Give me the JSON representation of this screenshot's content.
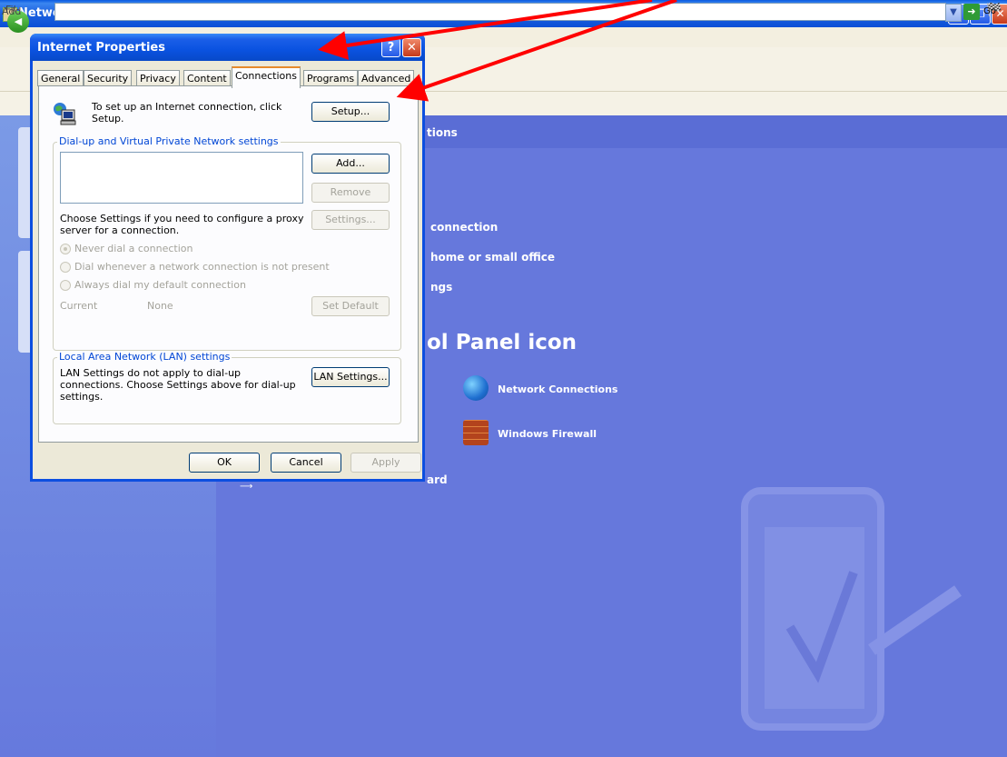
{
  "background_window": {
    "title": "Network and Internet Connections",
    "menu_visible_text": "Fil",
    "address_label": "Add",
    "go_label": "Go",
    "content_header": "tions",
    "tasks": [
      "connection",
      "home or small office",
      "ngs"
    ],
    "heading": "ol Panel icon",
    "control_panel_icons": [
      {
        "label": "Network Connections",
        "icon": "network-connections-icon"
      },
      {
        "label": "Windows Firewall",
        "icon": "windows-firewall-icon"
      }
    ],
    "bottom_task": "ard"
  },
  "dialog": {
    "title": "Internet Properties",
    "help_symbol": "?",
    "close_symbol": "✕",
    "tabs": [
      "General",
      "Security",
      "Privacy",
      "Content",
      "Connections",
      "Programs",
      "Advanced"
    ],
    "active_tab": "Connections",
    "setup_text": "To set up an Internet connection, click Setup.",
    "setup_button": "Setup...",
    "dialup_group_title": "Dial-up and Virtual Private Network settings",
    "add_button": "Add...",
    "remove_button": "Remove",
    "settings_button": "Settings...",
    "proxy_text": "Choose Settings if you need to configure a proxy server for a connection.",
    "radio_options": [
      "Never dial a connection",
      "Dial whenever a network connection is not present",
      "Always dial my default connection"
    ],
    "current_label": "Current",
    "current_value": "None",
    "set_default_button": "Set Default",
    "lan_group_title": "Local Area Network (LAN) settings",
    "lan_text": "LAN Settings do not apply to dial-up connections. Choose Settings above for dial-up settings.",
    "lan_settings_button": "LAN Settings...",
    "ok_button": "OK",
    "cancel_button": "Cancel",
    "apply_button": "Apply"
  },
  "colors": {
    "annotation_arrow": "#ff0000",
    "xp_blue": "#0a52e0",
    "panel_background": "#ece9d8",
    "content_background": "#6678dc"
  }
}
